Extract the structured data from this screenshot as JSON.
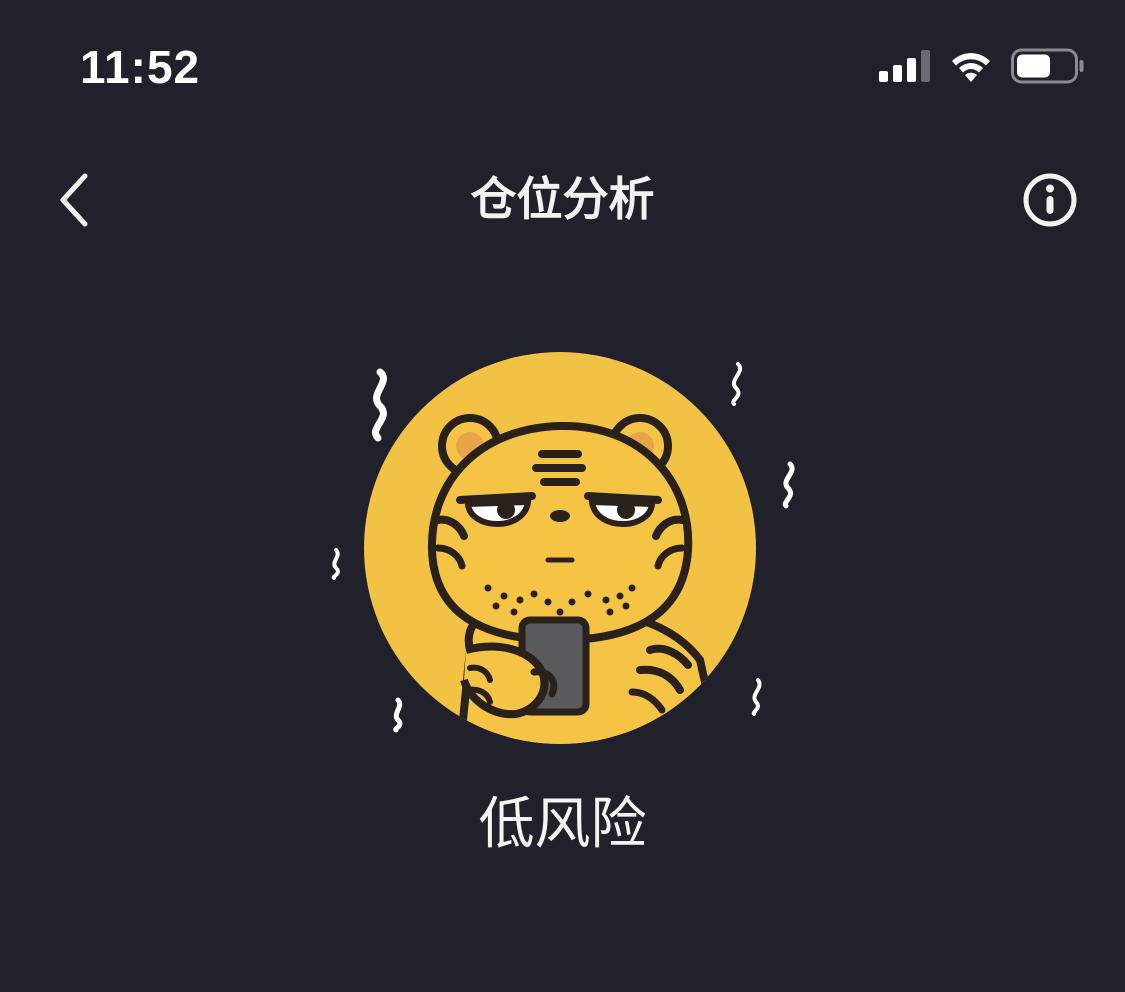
{
  "status_bar": {
    "time": "11:52",
    "signal_icon": "cellular-signal-icon",
    "wifi_icon": "wifi-icon",
    "battery_icon": "battery-icon",
    "battery_level": 0.6
  },
  "nav": {
    "back_icon": "chevron-left-icon",
    "title": "仓位分析",
    "info_icon": "info-circle-icon"
  },
  "avatar": {
    "icon": "tiger-mascot-icon",
    "background_color": "#f2c244"
  },
  "risk": {
    "label": "低风险"
  },
  "colors": {
    "background": "#20212a",
    "text": "#f2f2f2",
    "accent_yellow": "#f2c244"
  }
}
